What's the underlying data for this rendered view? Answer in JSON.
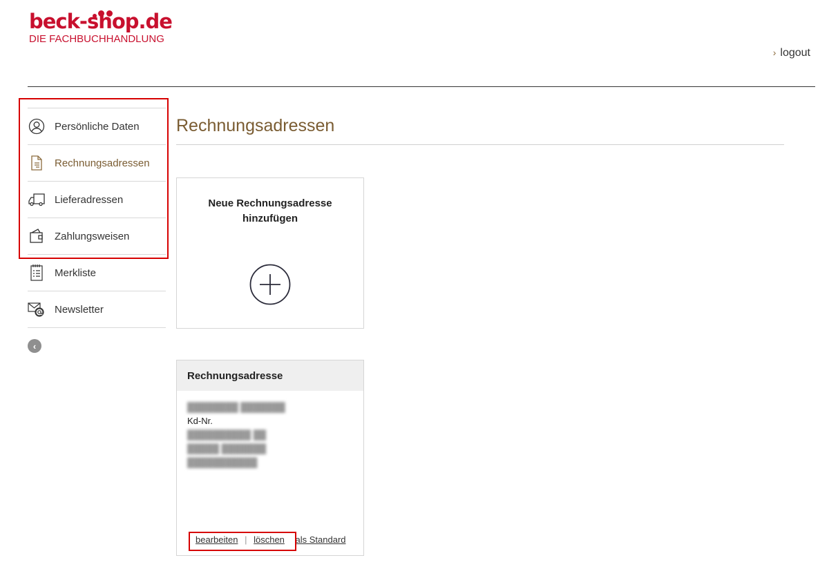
{
  "header": {
    "logo_name": "beck-shop.de",
    "logo_subtitle": "DIE FACHBUCHHANDLUNG",
    "logout_label": "logout"
  },
  "sidebar": {
    "items": [
      {
        "label": "Persönliche Daten",
        "icon": "user-circle-icon"
      },
      {
        "label": "Rechnungsadressen",
        "icon": "document-icon",
        "active": true
      },
      {
        "label": "Lieferadressen",
        "icon": "truck-icon"
      },
      {
        "label": "Zahlungsweisen",
        "icon": "wallet-icon"
      },
      {
        "label": "Merkliste",
        "icon": "checklist-icon"
      },
      {
        "label": "Newsletter",
        "icon": "mail-at-icon"
      }
    ],
    "back_icon": "chevron-left-circle-icon"
  },
  "main": {
    "title": "Rechnungsadressen",
    "new_card_label": "Neue Rechnungsadresse hinzufügen",
    "address_card": {
      "title": "Rechnungsadresse",
      "customer_number_label": "Kd-Nr.",
      "actions": {
        "edit": "bearbeiten",
        "separator": "|",
        "delete": "löschen",
        "set_default": "als Standard"
      }
    }
  },
  "colors": {
    "brand_red": "#c8102e",
    "accent_brown": "#7a5c32",
    "highlight_red": "#d60000"
  }
}
